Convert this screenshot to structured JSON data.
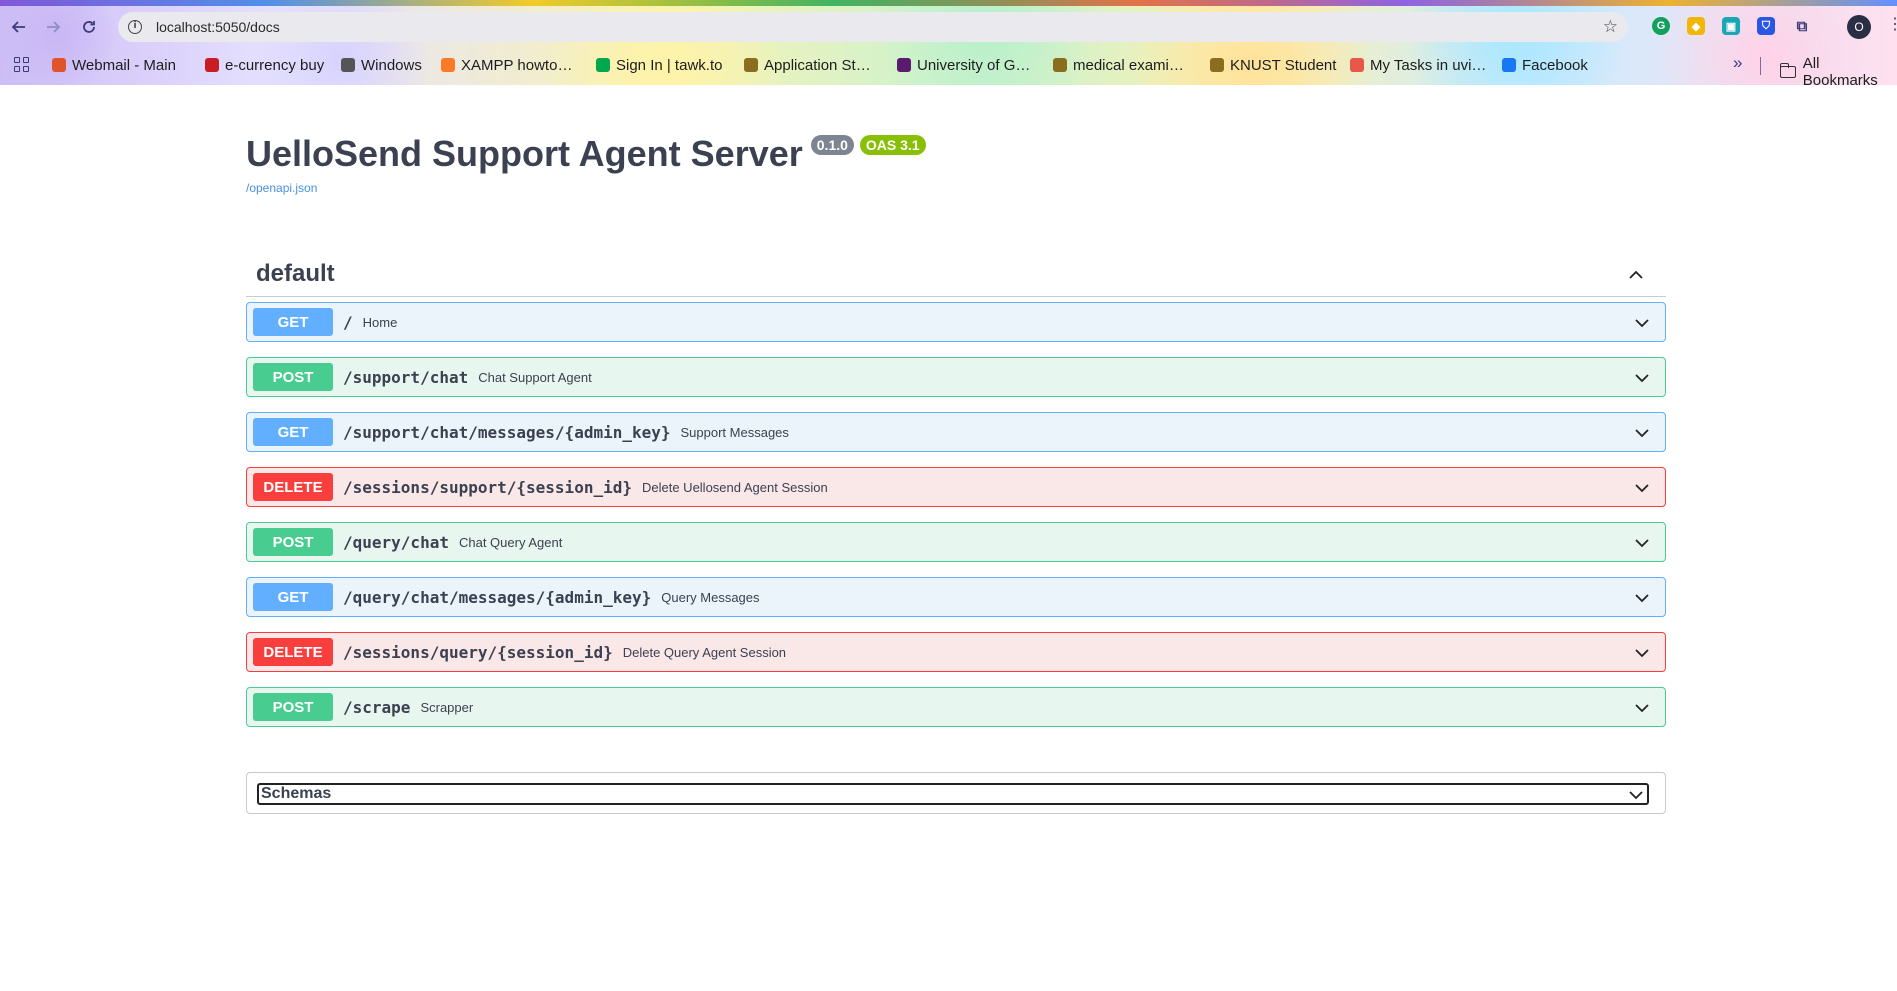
{
  "browser": {
    "url": "localhost:5050/docs",
    "profile_initial": "O",
    "bookmarks": [
      {
        "label": "Webmail - Main",
        "icon": "webmail-icon",
        "color": "#e0532b"
      },
      {
        "label": "e-currency buy",
        "icon": "z-icon",
        "color": "#c81d25"
      },
      {
        "label": "Windows",
        "icon": "globe-icon",
        "color": "#555555"
      },
      {
        "label": "XAMPP howto…",
        "icon": "xampp-icon",
        "color": "#fb7a24"
      },
      {
        "label": "Sign In | tawk.to",
        "icon": "tawk-icon",
        "color": "#03a84e"
      },
      {
        "label": "Application St…",
        "icon": "crest-icon",
        "color": "#8a6d1f"
      },
      {
        "label": "University of G…",
        "icon": "university-icon",
        "color": "#5a1b6e"
      },
      {
        "label": "medical exami…",
        "icon": "crest-icon",
        "color": "#8a6d1f"
      },
      {
        "label": "KNUST Student",
        "icon": "crest-icon",
        "color": "#8a6d1f"
      },
      {
        "label": "My Tasks in uvi…",
        "icon": "tasks-icon",
        "color": "#e8584a"
      },
      {
        "label": "Facebook",
        "icon": "facebook-icon",
        "color": "#1877f2"
      }
    ],
    "all_bookmarks": "All Bookmarks"
  },
  "header": {
    "title": "UelloSend Support Agent Server",
    "version": "0.1.0",
    "oas": "OAS 3.1",
    "spec_link": "/openapi.json"
  },
  "section": {
    "name": "default"
  },
  "operations": [
    {
      "method": "GET",
      "path": "/",
      "summary": "Home"
    },
    {
      "method": "POST",
      "path": "/support/chat",
      "summary": "Chat Support Agent"
    },
    {
      "method": "GET",
      "path": "/support/chat/messages/{admin_key}",
      "summary": "Support Messages"
    },
    {
      "method": "DELETE",
      "path": "/sessions/support/{session_id}",
      "summary": "Delete Uellosend Agent Session"
    },
    {
      "method": "POST",
      "path": "/query/chat",
      "summary": "Chat Query Agent"
    },
    {
      "method": "GET",
      "path": "/query/chat/messages/{admin_key}",
      "summary": "Query Messages"
    },
    {
      "method": "DELETE",
      "path": "/sessions/query/{session_id}",
      "summary": "Delete Query Agent Session"
    },
    {
      "method": "POST",
      "path": "/scrape",
      "summary": "Scrapper"
    }
  ],
  "schemas": {
    "label": "Schemas"
  },
  "colors": {
    "get": "#61affe",
    "post": "#49cc90",
    "delete": "#f93e3e",
    "version_badge": "#7d8492",
    "oas_badge": "#89bf04",
    "link": "#4990e2"
  }
}
